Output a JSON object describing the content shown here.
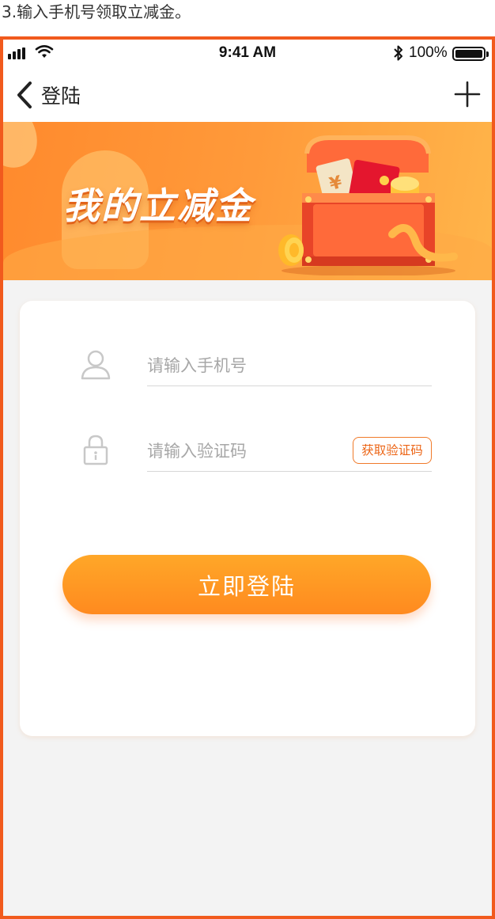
{
  "caption": "3.输入手机号领取立减金。",
  "status_bar": {
    "time": "9:41 AM",
    "battery_percent": "100%",
    "icons": [
      "signal-icon",
      "wifi-icon",
      "bluetooth-icon",
      "battery-icon"
    ]
  },
  "nav": {
    "title": "登陆",
    "icons": [
      "back-chevron-icon",
      "plus-icon"
    ]
  },
  "banner": {
    "title": "我的立减金",
    "icon": "treasure-chest-icon"
  },
  "form": {
    "phone_placeholder": "请输入手机号",
    "phone_value": "",
    "code_placeholder": "请输入验证码",
    "code_value": "",
    "get_code_label": "获取验证码",
    "login_label": "立即登陆",
    "icons": [
      "user-icon",
      "lock-icon"
    ]
  },
  "colors": {
    "accent": "#ff8a1f",
    "frame_border": "#f15a1d",
    "code_button_border": "#f07a2a",
    "background": "#f3f3f3"
  }
}
